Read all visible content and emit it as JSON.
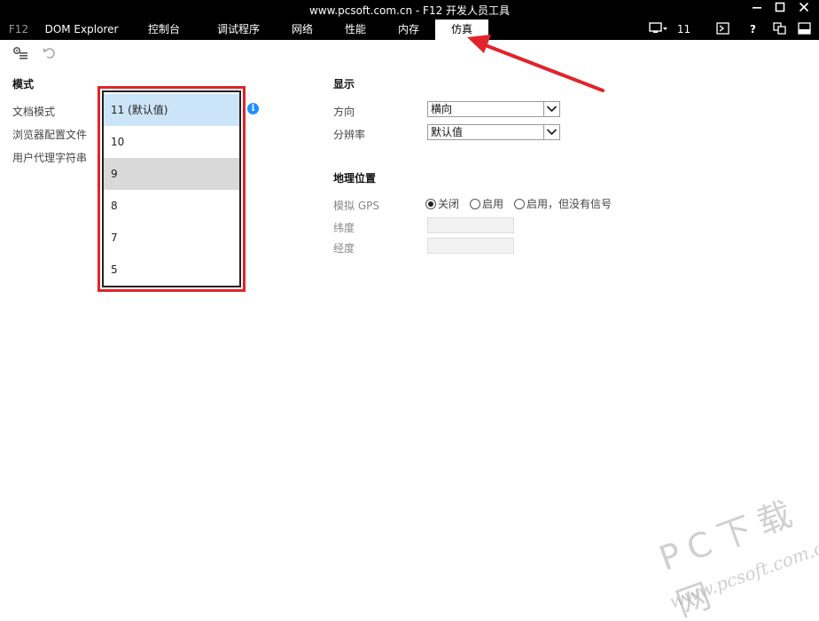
{
  "window": {
    "title": "www.pcsoft.com.cn - F12 开发人员工具",
    "minimize_icon": "minimize-icon",
    "maximize_icon": "maximize-icon",
    "close_icon": "close-icon"
  },
  "tabs": [
    {
      "label": "F12"
    },
    {
      "label": "DOM Explorer"
    },
    {
      "label": "控制台"
    },
    {
      "label": "调试程序"
    },
    {
      "label": "网络"
    },
    {
      "label": "性能"
    },
    {
      "label": "内存"
    },
    {
      "label": "仿真"
    }
  ],
  "active_tab": "仿真",
  "tab_right": {
    "target_label": "11",
    "help_label": "?"
  },
  "mode_section": {
    "heading": "模式",
    "labels": [
      "文档模式",
      "浏览器配置文件",
      "用户代理字符串"
    ],
    "document_mode_options": [
      "11 (默认值)",
      "10",
      "9",
      "8",
      "7",
      "5"
    ],
    "selected_option": "11 (默认值)",
    "hovered_option": "9"
  },
  "display_section": {
    "heading": "显示",
    "orientation_label": "方向",
    "orientation_value": "横向",
    "resolution_label": "分辨率",
    "resolution_value": "默认值"
  },
  "geo_section": {
    "heading": "地理位置",
    "gps_label": "模拟 GPS",
    "gps_options": [
      "关闭",
      "启用",
      "启用，但没有信号"
    ],
    "gps_selected": "关闭",
    "latitude_label": "纬度",
    "longitude_label": "经度"
  },
  "watermark": {
    "line1": "PC下载网",
    "line2": "www.pcsoft.com.cn"
  },
  "colors": {
    "highlight_red": "#e0242a",
    "selected_blue": "#cce4f7",
    "info_blue": "#1e90ff"
  }
}
